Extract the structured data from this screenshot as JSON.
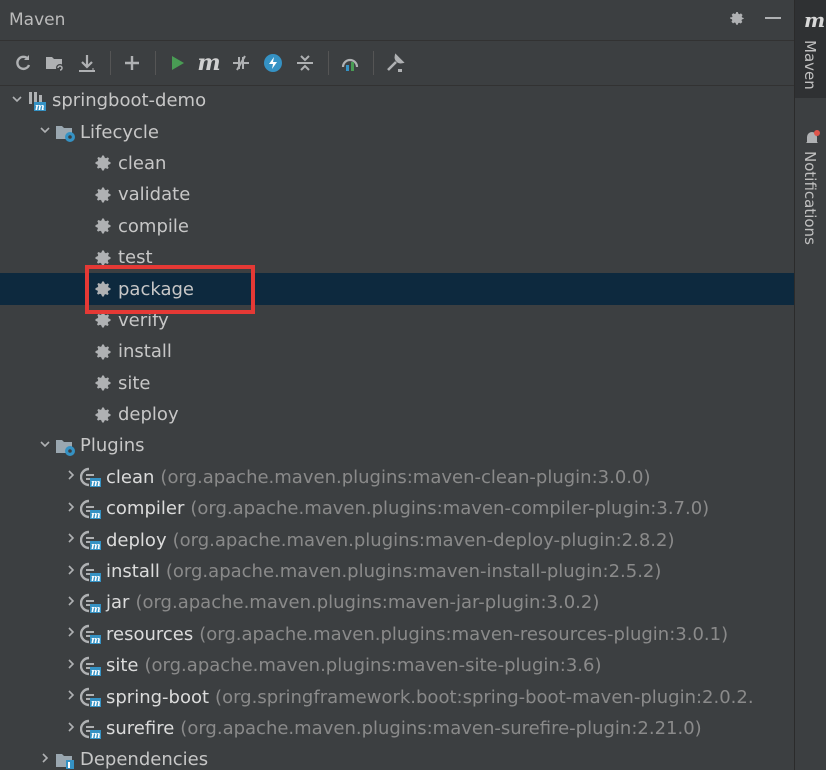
{
  "panel": {
    "title": "Maven"
  },
  "sidebar": {
    "maven_tab": "Maven",
    "notifications_tab": "Notifications",
    "m_logo": "m"
  },
  "toolbar": {
    "buttons": [
      {
        "name": "reload-icon"
      },
      {
        "name": "add-maven-projects-icon"
      },
      {
        "name": "download-icon"
      },
      {
        "name": "plus-icon"
      },
      {
        "name": "run-icon"
      },
      {
        "name": "execute-goal-icon"
      },
      {
        "name": "toggle-offline-icon"
      },
      {
        "name": "skip-tests-icon"
      },
      {
        "name": "collapse-all-icon"
      },
      {
        "name": "show-dependencies-icon"
      },
      {
        "name": "settings-wrench-icon"
      }
    ],
    "m_label": "m"
  },
  "tree": {
    "project": "springboot-demo",
    "lifecycle": {
      "label": "Lifecycle",
      "items": [
        "clean",
        "validate",
        "compile",
        "test",
        "package",
        "verify",
        "install",
        "site",
        "deploy"
      ],
      "selected": "package"
    },
    "plugins": {
      "label": "Plugins",
      "items": [
        {
          "name": "clean",
          "coords": "(org.apache.maven.plugins:maven-clean-plugin:3.0.0)"
        },
        {
          "name": "compiler",
          "coords": "(org.apache.maven.plugins:maven-compiler-plugin:3.7.0)"
        },
        {
          "name": "deploy",
          "coords": "(org.apache.maven.plugins:maven-deploy-plugin:2.8.2)"
        },
        {
          "name": "install",
          "coords": "(org.apache.maven.plugins:maven-install-plugin:2.5.2)"
        },
        {
          "name": "jar",
          "coords": "(org.apache.maven.plugins:maven-jar-plugin:3.0.2)"
        },
        {
          "name": "resources",
          "coords": "(org.apache.maven.plugins:maven-resources-plugin:3.0.1)"
        },
        {
          "name": "site",
          "coords": "(org.apache.maven.plugins:maven-site-plugin:3.6)"
        },
        {
          "name": "spring-boot",
          "coords": "(org.springframework.boot:spring-boot-maven-plugin:2.0.2."
        },
        {
          "name": "surefire",
          "coords": "(org.apache.maven.plugins:maven-surefire-plugin:2.21.0)"
        }
      ]
    },
    "dependencies": {
      "label": "Dependencies"
    }
  },
  "colors": {
    "accent_run": "#499c54",
    "selection": "#0d293e",
    "highlight_box": "#e53935"
  }
}
